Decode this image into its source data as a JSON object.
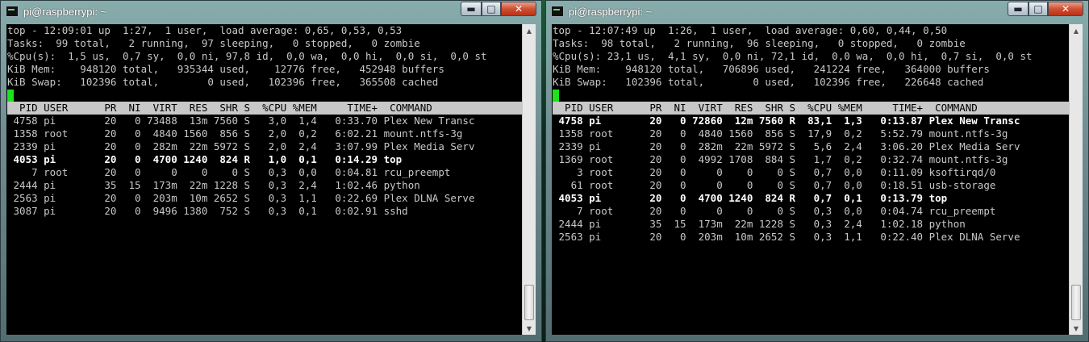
{
  "windows": [
    {
      "title": "pi@raspberrypi: ~",
      "controls": {
        "minimize": "▬",
        "maximize": "□",
        "close": "✕"
      },
      "top_lines": [
        "top - 12:09:01 up  1:27,  1 user,  load average: 0,65, 0,53, 0,53",
        "Tasks:  99 total,   2 running,  97 sleeping,   0 stopped,   0 zombie",
        "%Cpu(s):  1,5 us,  0,7 sy,  0,0 ni, 97,8 id,  0,0 wa,  0,0 hi,  0,0 si,  0,0 st",
        "KiB Mem:    948120 total,   935344 used,    12776 free,   452948 buffers",
        "KiB Swap:   102396 total,        0 used,   102396 free,   365508 cached"
      ],
      "column_header": "  PID USER      PR  NI  VIRT  RES  SHR S  %CPU %MEM     TIME+  COMMAND",
      "processes": [
        {
          "text": " 4758 pi        20   0 73488  13m 7560 S   3,0  1,4   0:33.70 Plex New Transc",
          "bold": false
        },
        {
          "text": " 1358 root      20   0  4840 1560  856 S   2,0  0,2   6:02.21 mount.ntfs-3g",
          "bold": false
        },
        {
          "text": " 2339 pi        20   0  282m  22m 5972 S   2,0  2,4   3:07.99 Plex Media Serv",
          "bold": false
        },
        {
          "text": " 4053 pi        20   0  4700 1240  824 R   1,0  0,1   0:14.29 top",
          "bold": true
        },
        {
          "text": "    7 root      20   0     0    0    0 S   0,3  0,0   0:04.81 rcu_preempt",
          "bold": false
        },
        {
          "text": " 2444 pi        35  15  173m  22m 1228 S   0,3  2,4   1:02.46 python",
          "bold": false
        },
        {
          "text": " 2563 pi        20   0  203m  10m 2652 S   0,3  1,1   0:22.69 Plex DLNA Serve",
          "bold": false
        },
        {
          "text": " 3087 pi        20   0  9496 1380  752 S   0,3  0,1   0:02.91 sshd",
          "bold": false
        }
      ]
    },
    {
      "title": "pi@raspberrypi: ~",
      "controls": {
        "minimize": "▬",
        "maximize": "□",
        "close": "✕"
      },
      "top_lines": [
        "top - 12:07:49 up  1:26,  1 user,  load average: 0,60, 0,44, 0,50",
        "Tasks:  98 total,   2 running,  96 sleeping,   0 stopped,   0 zombie",
        "%Cpu(s): 23,1 us,  4,1 sy,  0,0 ni, 72,1 id,  0,0 wa,  0,0 hi,  0,7 si,  0,0 st",
        "KiB Mem:    948120 total,   706896 used,   241224 free,   364000 buffers",
        "KiB Swap:   102396 total,        0 used,   102396 free,   226648 cached"
      ],
      "column_header": "  PID USER      PR  NI  VIRT  RES  SHR S  %CPU %MEM     TIME+  COMMAND",
      "processes": [
        {
          "text": " 4758 pi        20   0 72860  12m 7560 R  83,1  1,3   0:13.87 Plex New Transc",
          "bold": true
        },
        {
          "text": " 1358 root      20   0  4840 1560  856 S  17,9  0,2   5:52.79 mount.ntfs-3g",
          "bold": false
        },
        {
          "text": " 2339 pi        20   0  282m  22m 5972 S   5,6  2,4   3:06.20 Plex Media Serv",
          "bold": false
        },
        {
          "text": " 1369 root      20   0  4992 1708  884 S   1,7  0,2   0:32.74 mount.ntfs-3g",
          "bold": false
        },
        {
          "text": "    3 root      20   0     0    0    0 S   0,7  0,0   0:11.09 ksoftirqd/0",
          "bold": false
        },
        {
          "text": "   61 root      20   0     0    0    0 S   0,7  0,0   0:18.51 usb-storage",
          "bold": false
        },
        {
          "text": " 4053 pi        20   0  4700 1240  824 R   0,7  0,1   0:13.79 top",
          "bold": true
        },
        {
          "text": "    7 root      20   0     0    0    0 S   0,3  0,0   0:04.74 rcu_preempt",
          "bold": false
        },
        {
          "text": " 2444 pi        35  15  173m  22m 1228 S   0,3  2,4   1:02.18 python",
          "bold": false
        },
        {
          "text": " 2563 pi        20   0  203m  10m 2652 S   0,3  1,1   0:22.40 Plex DLNA Serve",
          "bold": false
        }
      ]
    }
  ]
}
